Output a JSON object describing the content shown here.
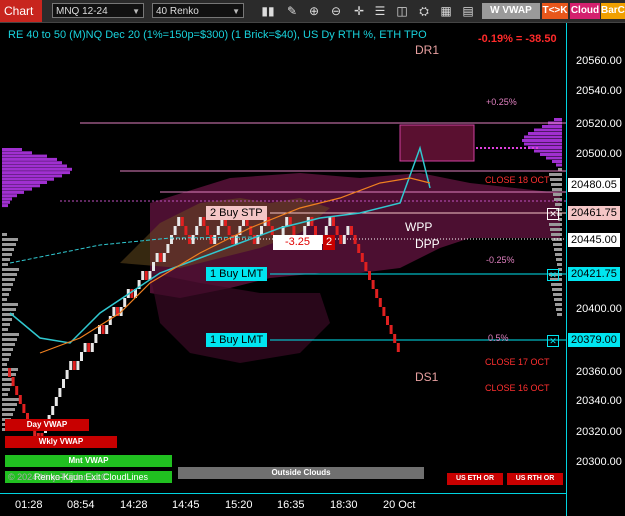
{
  "toolbar": {
    "title": "Chart",
    "instrument": "MNQ 12-24",
    "bar_type": "40 Renko",
    "buttons": [
      {
        "name": "w-vwap",
        "label": "W VWAP",
        "bg": "#9a9a9a",
        "fg": "#ffffff"
      },
      {
        "name": "t-k",
        "label": "T<>K",
        "bg": "#e8571b",
        "fg": "#ffffff"
      },
      {
        "name": "cloud",
        "label": "Cloud",
        "bg": "#d4206e",
        "fg": "#ffffff"
      },
      {
        "name": "barcolor",
        "label": "BarCo",
        "bg": "#f0a000",
        "fg": "#ffffff"
      }
    ]
  },
  "header": {
    "text": "RE 40 to 50 (M)NQ Dec 20 (1%=150p=$300) (1 Brick=$40), US Dy RTH %, ETH TPO",
    "pnl": "-0.19% = -38.50"
  },
  "colors": {
    "accent": "#00d4e0",
    "bull": "#e8e8e8",
    "bear": "#e02020",
    "cloud": "#8b1c5a",
    "tpo": "#a030d0"
  },
  "yaxis": {
    "ticks": [
      "20560.00",
      "20540.00",
      "20520.00",
      "20500.00",
      "20400.00",
      "20380.00",
      "20360.00",
      "20340.00",
      "20320.00",
      "20300.00"
    ],
    "price_tags": [
      {
        "value": "20480.05",
        "bg": "#ffffff",
        "fg": "#000000"
      },
      {
        "value": "20461.75",
        "bg": "#f4c6c6",
        "fg": "#000000"
      },
      {
        "value": "20445.00",
        "bg": "#ffffff",
        "fg": "#000000"
      },
      {
        "value": "20421.75",
        "bg": "#00e5f0",
        "fg": "#000000"
      },
      {
        "value": "20379.00",
        "bg": "#00e5f0",
        "fg": "#000000"
      }
    ]
  },
  "xaxis": {
    "ticks": [
      "01:28",
      "08:54",
      "14:28",
      "14:45",
      "15:20",
      "16:35",
      "18:30",
      "20 Oct"
    ]
  },
  "orders": [
    {
      "label": "2 Buy STP",
      "bg": "#f4c6c6",
      "fg": "#000000"
    },
    {
      "label": "1 Buy LMT",
      "bg": "#00e5f0",
      "fg": "#000000"
    },
    {
      "label": "1 Buy LMT",
      "bg": "#00e5f0",
      "fg": "#000000"
    }
  ],
  "position": {
    "pnl": "-3.25",
    "qty": "2"
  },
  "levels": {
    "dr1": "DR1",
    "wpp": "WPP",
    "dpp": "DPP",
    "ds1": "DS1",
    "pct_up": "+0.25%",
    "pct_down": "-0.25%",
    "pct_05": "0.5%",
    "close18": "CLOSE 18 OCT",
    "close17": "CLOSE 17 OCT",
    "close16": "CLOSE 16 OCT"
  },
  "vwap_buttons": [
    {
      "label": "Day VWAP",
      "bg": "#c80000"
    },
    {
      "label": "Wkly VWAP",
      "bg": "#c80000"
    },
    {
      "label": "Mnt VWAP",
      "bg": "#20c020"
    },
    {
      "label": "Outside Clouds",
      "bg": "#707070"
    },
    {
      "label": "US ETH OR",
      "bg": "#c80000"
    },
    {
      "label": "US RTH OR",
      "bg": "#c80000"
    }
  ],
  "watermark": "© 2024 NinjaTrader, LLC",
  "footer_label": "Renko-Kijun Exit CloudLines"
}
